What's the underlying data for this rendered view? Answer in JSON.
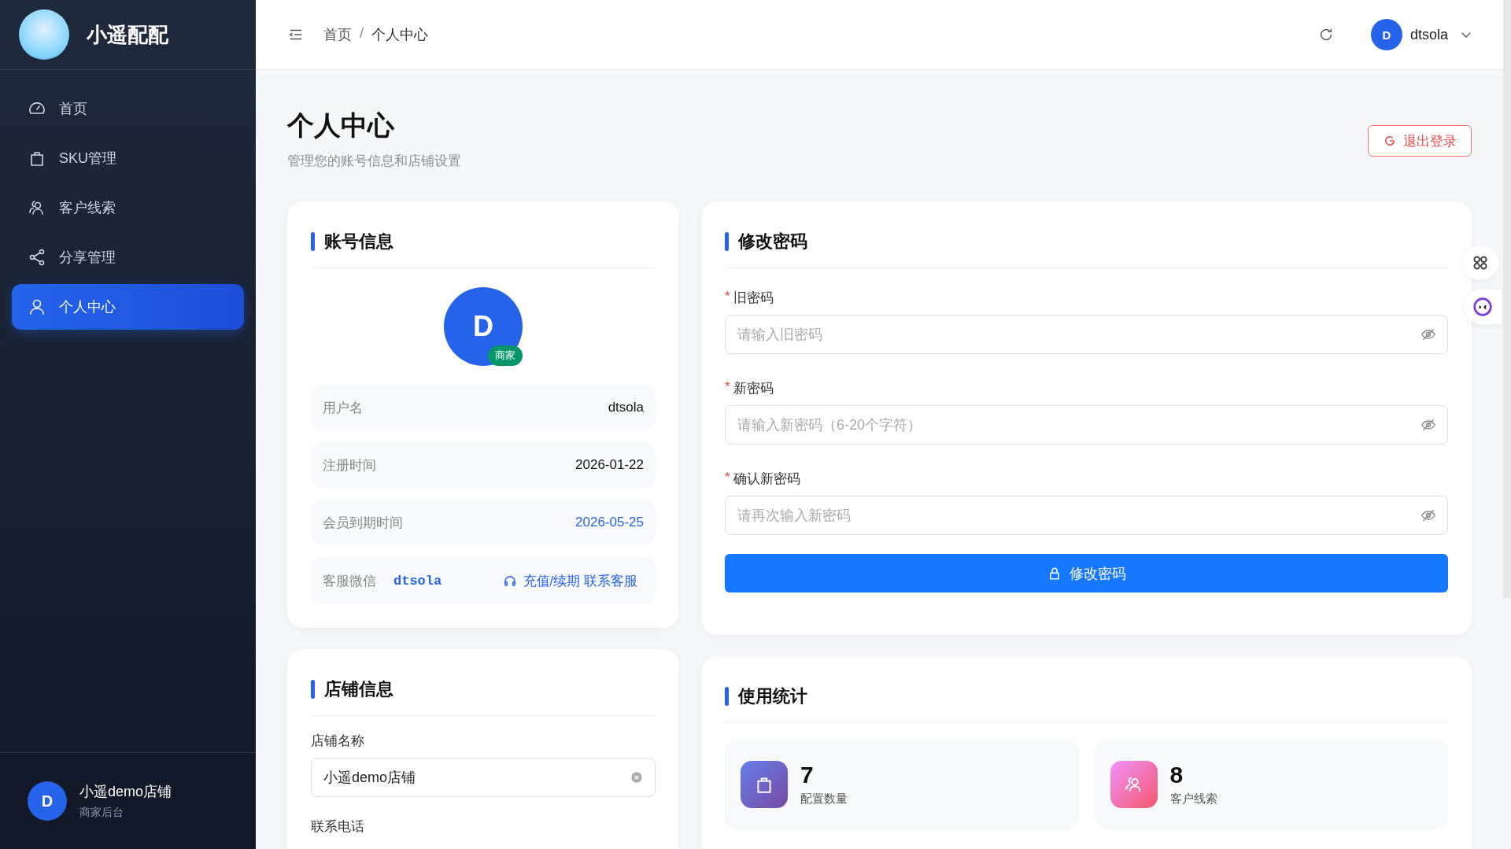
{
  "brand": {
    "name": "小遥配配"
  },
  "nav": [
    {
      "label": "首页",
      "kind": "gauge",
      "selected": false
    },
    {
      "label": "SKU管理",
      "kind": "bag",
      "selected": false
    },
    {
      "label": "客户线索",
      "kind": "users",
      "selected": false
    },
    {
      "label": "分享管理",
      "kind": "share",
      "selected": false
    },
    {
      "label": "个人中心",
      "kind": "user",
      "selected": true
    }
  ],
  "shop": {
    "avatar": "D",
    "name": "小遥demo店铺",
    "subtitle": "商家后台"
  },
  "header": {
    "breadcrumb": [
      "首页",
      "个人中心"
    ],
    "breadcrumb_separator": "/",
    "user": {
      "avatar": "D",
      "name": "dtsola"
    }
  },
  "page": {
    "title": "个人中心",
    "subtitle": "管理您的账号信息和店铺设置",
    "logout": "退出登录"
  },
  "account": {
    "title": "账号信息",
    "avatar": "D",
    "badge": "商家",
    "rows": [
      {
        "label": "用户名",
        "value": "dtsola",
        "highlight": false
      },
      {
        "label": "注册时间",
        "value": "2026-01-22",
        "highlight": false
      },
      {
        "label": "会员到期时间",
        "value": "2026-05-25",
        "highlight": true
      }
    ],
    "wechat": {
      "label": "客服微信",
      "id": "dtsola",
      "link": "充值/续期 联系客服"
    }
  },
  "password": {
    "title": "修改密码",
    "required_mark": "*",
    "fields": [
      {
        "label": "旧密码",
        "placeholder": "请输入旧密码",
        "required": true
      },
      {
        "label": "新密码",
        "placeholder": "请输入新密码（6-20个字符）",
        "required": true
      },
      {
        "label": "确认新密码",
        "placeholder": "请再次输入新密码",
        "required": true
      }
    ],
    "submit": "修改密码"
  },
  "store": {
    "title": "店铺信息",
    "fields": [
      {
        "label": "店铺名称",
        "value": "小遥demo店铺"
      }
    ],
    "next_label": "联系电话"
  },
  "stats": {
    "title": "使用统计",
    "items": [
      {
        "value": "7",
        "label": "配置数量",
        "kind": "bag"
      },
      {
        "value": "8",
        "label": "客户线索",
        "kind": "users"
      }
    ]
  }
}
